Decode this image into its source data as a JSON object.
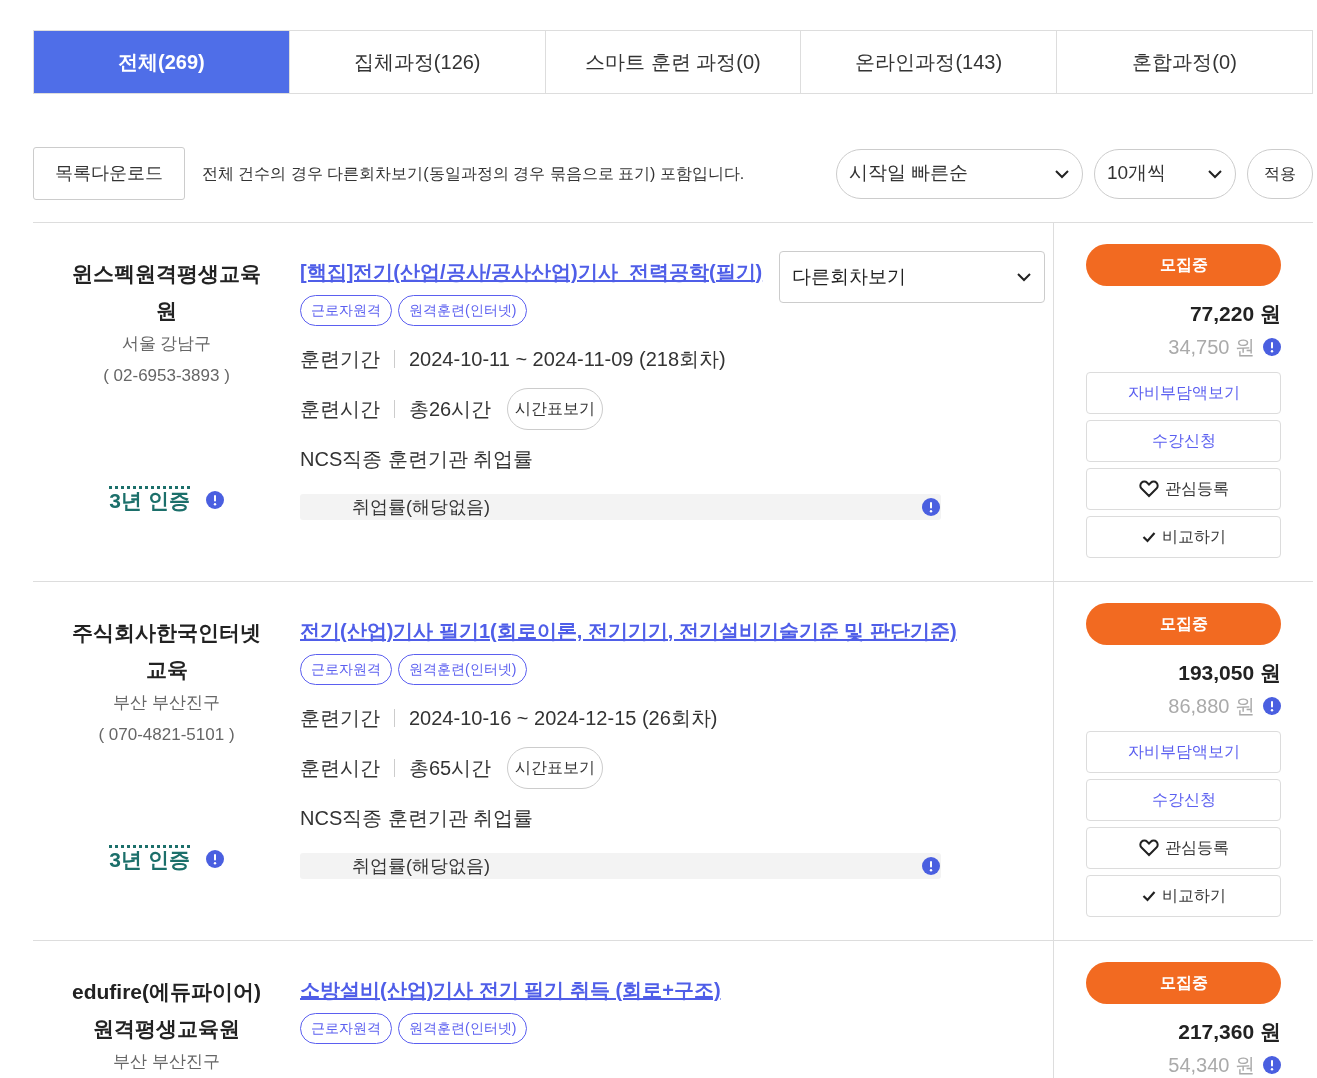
{
  "tabs": [
    {
      "label": "전체(269)",
      "selected": true
    },
    {
      "label": "집체과정(126)",
      "selected": false
    },
    {
      "label": "스마트 훈련 과정(0)",
      "selected": false
    },
    {
      "label": "온라인과정(143)",
      "selected": false
    },
    {
      "label": "혼합과정(0)",
      "selected": false
    }
  ],
  "toolbar": {
    "download_button": "목록다운로드",
    "notice": "전체 건수의 경우 다른회차보기(동일과정의 경우 묶음으로 표기) 포함입니다.",
    "sort_select": "시작일 빠른순",
    "page_size_select": "10개씩",
    "apply_button": "적용"
  },
  "courses": [
    {
      "institution": "윈스펙원격평생교육원",
      "region": "서울 강남구",
      "phone": "( 02-6953-3893 )",
      "certification": "3년 인증",
      "title": "[핵집]전기(산업/공사/공사산업)기사_전력공학(필기)",
      "tags": [
        "근로자원격",
        "원격훈련(인터넷)"
      ],
      "other_rounds_select": "다른회차보기",
      "period_label": "훈련기간",
      "period": "2024-10-11 ~ 2024-11-09 (218회차)",
      "hours_label": "훈련시간",
      "hours": "총26시간",
      "timetable_button": "시간표보기",
      "ncs_label": "NCS직종 훈련기관 취업률",
      "employment": "취업률(해당없음)",
      "status": "모집중",
      "price": "77,220 원",
      "self_pay": "34,750 원",
      "buttons": [
        {
          "kind": "link",
          "label": "자비부담액보기"
        },
        {
          "kind": "link",
          "label": "수강신청"
        },
        {
          "kind": "heart",
          "label": "관심등록"
        },
        {
          "kind": "check",
          "label": "비교하기"
        }
      ]
    },
    {
      "institution": "주식회사한국인터넷교육",
      "region": "부산 부산진구",
      "phone": "( 070-4821-5101 )",
      "certification": "3년 인증",
      "title": "전기(산업)기사 필기1(회로이론, 전기기기, 전기설비기술기준 및 판단기준)",
      "tags": [
        "근로자원격",
        "원격훈련(인터넷)"
      ],
      "period_label": "훈련기간",
      "period": "2024-10-16 ~ 2024-12-15 (26회차)",
      "hours_label": "훈련시간",
      "hours": "총65시간",
      "timetable_button": "시간표보기",
      "ncs_label": "NCS직종 훈련기관 취업률",
      "employment": "취업률(해당없음)",
      "status": "모집중",
      "price": "193,050 원",
      "self_pay": "86,880 원",
      "buttons": [
        {
          "kind": "link",
          "label": "자비부담액보기"
        },
        {
          "kind": "link",
          "label": "수강신청"
        },
        {
          "kind": "heart",
          "label": "관심등록"
        },
        {
          "kind": "check",
          "label": "비교하기"
        }
      ]
    },
    {
      "institution": "edufire(에듀파이어) 원격평생교육원",
      "region": "부산 부산진구",
      "title": "소방설비(산업)기사 전기 필기 취득 (회로+구조)",
      "tags": [
        "근로자원격",
        "원격훈련(인터넷)"
      ],
      "status": "모집중",
      "price": "217,360 원",
      "self_pay": "54,340 원"
    }
  ]
}
